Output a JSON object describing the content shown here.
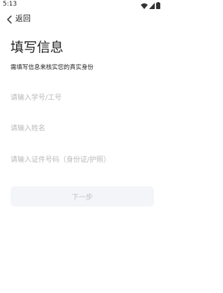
{
  "status_bar": {
    "time": "5:13",
    "icons": [
      "wifi-icon",
      "signal-icon",
      "battery-icon"
    ]
  },
  "nav": {
    "back_icon": "chevron-left-icon",
    "back_label": "返回"
  },
  "header": {
    "title": "填写信息",
    "subtitle": "需填写信息来核实您的真实身份"
  },
  "form": {
    "id_placeholder": "请输入学号/工号",
    "name_placeholder": "请输入姓名",
    "cert_placeholder": "请输入证件号码（身份证/护照）",
    "next_label": "下一步"
  },
  "colors": {
    "text": "#222222",
    "placeholder": "#b9b9bd",
    "button_bg": "#f4f5f8",
    "button_text": "#bfc1c7"
  }
}
